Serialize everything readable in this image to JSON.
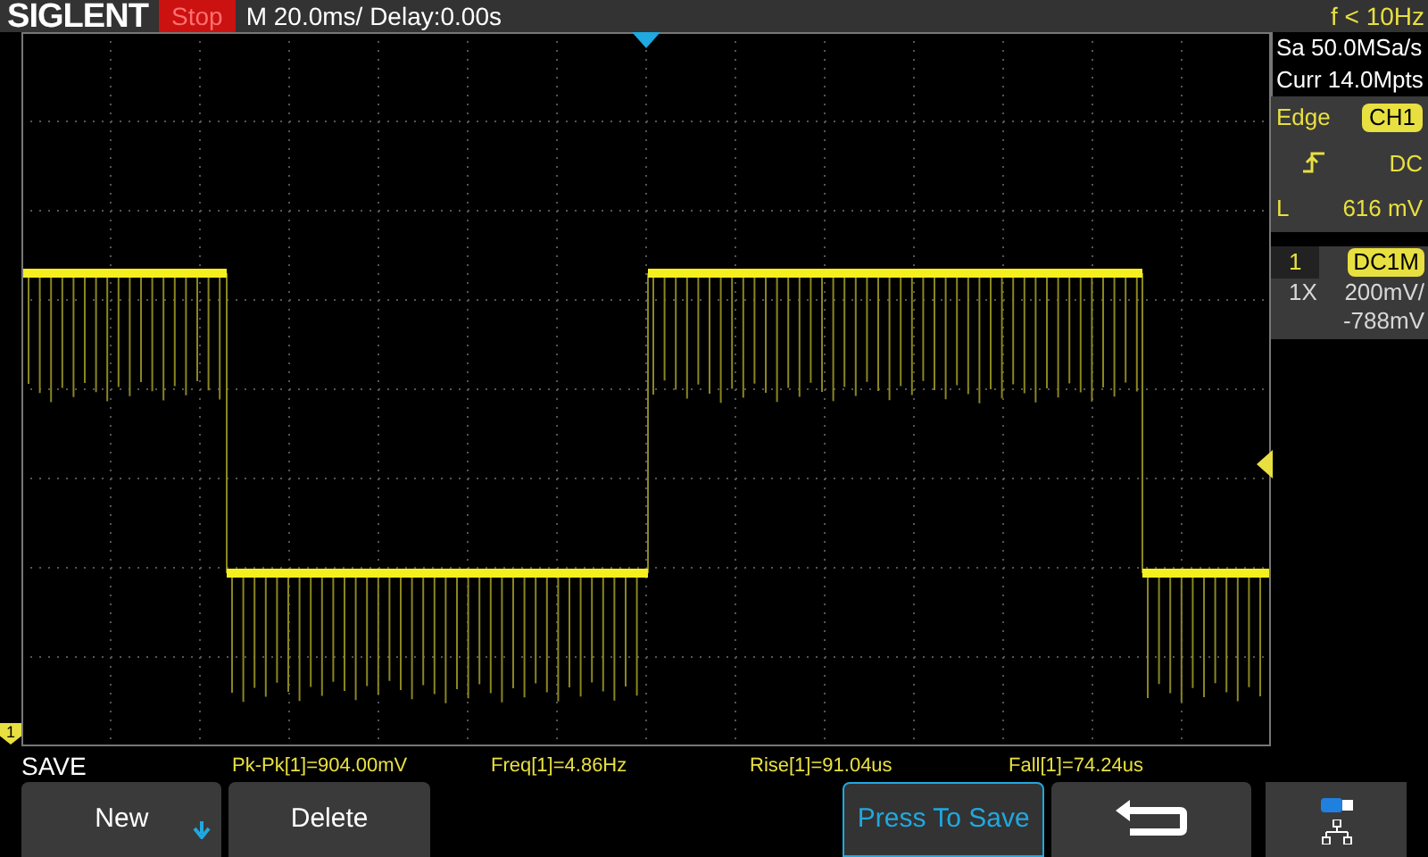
{
  "top_bar": {
    "logo": "SIGLENT",
    "run_state": "Stop",
    "timebase": "M 20.0ms/ Delay:0.00s",
    "frequency": "f < 10Hz"
  },
  "acquisition": {
    "sample_rate": "Sa 50.0MSa/s",
    "memory_depth": "Curr 14.0Mpts"
  },
  "trigger": {
    "type": "Edge",
    "source": "CH1",
    "coupling": "DC",
    "level_label": "L",
    "level": "616 mV"
  },
  "channel": {
    "number": "1",
    "coupling": "DC1M",
    "probe": "1X",
    "scale": "200mV/",
    "offset": "-788mV"
  },
  "channel_marker": "1",
  "menu_title": "SAVE",
  "measurements": [
    "Pk-Pk[1]=904.00mV",
    "Freq[1]=4.86Hz",
    "Rise[1]=91.04us",
    "Fall[1]=74.24us"
  ],
  "softkeys": [
    {
      "kind": "dropdown",
      "label": "New"
    },
    {
      "kind": "plain",
      "label": "Delete"
    },
    {
      "kind": "empty"
    },
    {
      "kind": "highlight",
      "label": "Press To Save"
    },
    {
      "kind": "back"
    }
  ]
}
